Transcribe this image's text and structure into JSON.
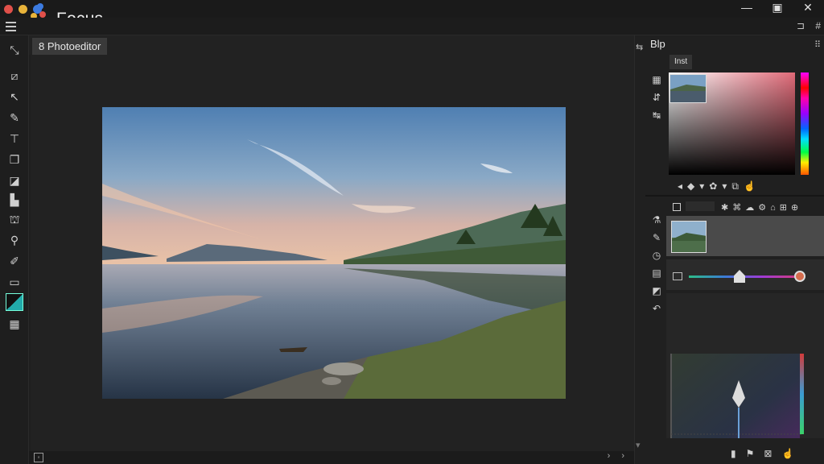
{
  "app": {
    "title": "Focus"
  },
  "window": {
    "minimize": "—",
    "maximize": "▣",
    "close": "✕"
  },
  "menubar": {
    "right_icons": [
      "⊐",
      "#"
    ]
  },
  "document": {
    "tab_label": "8 Photoeditor"
  },
  "panel": {
    "tab": "Blp",
    "more": "⠿",
    "subtab": "Inst",
    "icons_top": [
      "▦",
      "⇵",
      "↹"
    ],
    "icons_mid": [
      "⚗",
      "✎",
      "◷",
      "▤",
      "◩",
      "↶"
    ],
    "color_tools": [
      "◂",
      "◆",
      "▾",
      "✿",
      "▾",
      "⧉",
      "☝"
    ],
    "layer_tools": [
      "✱",
      "⌘",
      "☁",
      "⚙",
      "⌂",
      "⊞",
      "⊕"
    ],
    "bottom_icons": [
      "▮",
      "⚑",
      "⊠",
      "☝"
    ]
  },
  "status": {
    "nav": [
      "›",
      "›"
    ]
  },
  "colors": {
    "accent": "#0b6e63",
    "title_bg": "#1a1a1a",
    "panel_bg": "#202020",
    "traffic_red": "#e0504a",
    "traffic_yellow": "#e8b33a",
    "traffic_blue": "#3c7be0"
  },
  "tools": [
    "move-tool",
    "crop-tool",
    "pen-tool",
    "brush-tool",
    "text-tool",
    "clone-tool",
    "shape-tool",
    "stamp-tool",
    "gradient-tool",
    "zoom-tool",
    "eyedropper-tool",
    "rectangle-tool",
    "color-swatch",
    "grid-tool"
  ]
}
